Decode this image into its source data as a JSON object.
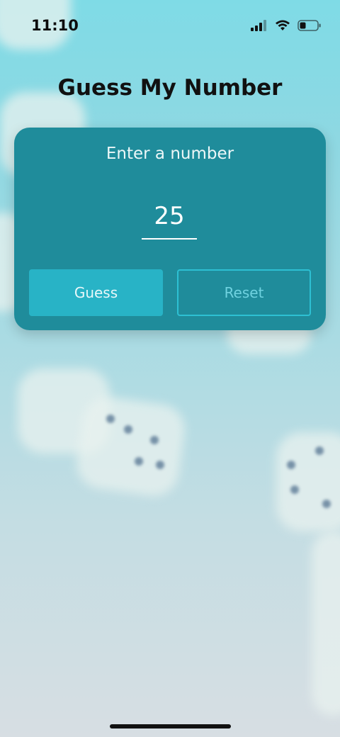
{
  "status_bar": {
    "time": "11:10",
    "icons": [
      "cellular-signal-icon",
      "wifi-icon",
      "battery-icon"
    ]
  },
  "app": {
    "title": "Guess My Number"
  },
  "card": {
    "prompt": "Enter a number",
    "input_value": "25",
    "guess_label": "Guess",
    "reset_label": "Reset"
  },
  "colors": {
    "card_background": "#1f8c9b",
    "guess_button": "#28b3c6",
    "reset_border": "#2dc0d3",
    "reset_text": "#6fd2e0"
  }
}
